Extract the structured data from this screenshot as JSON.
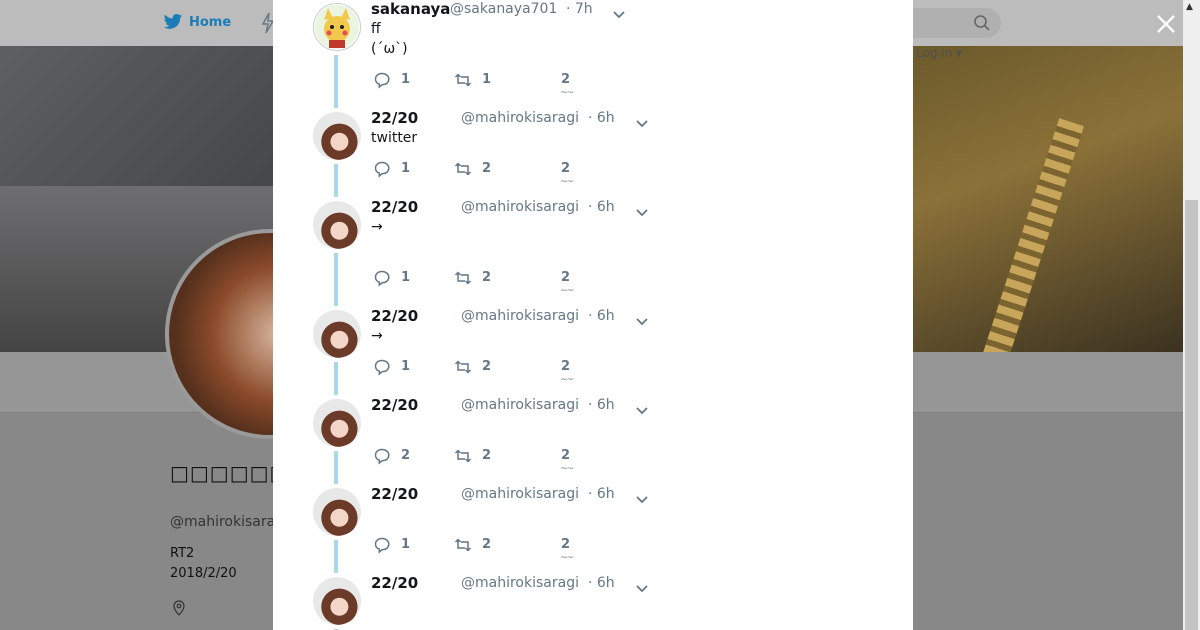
{
  "nav": {
    "home_label": "Home",
    "login_label": "Log in ▾"
  },
  "profile": {
    "name": "□□□□□□□□□□□□",
    "handle": "@mahirokisaragi",
    "bio": "RT2",
    "joined": "2018/2/20"
  },
  "tweets": [
    {
      "name": "sakanaya",
      "handle": "@sakanaya701",
      "time": "· 7h",
      "text": "ff\n(´ω`)",
      "replies": "1",
      "retweets": "1",
      "likes": "2"
    },
    {
      "name": "22/20",
      "handle": "@mahirokisaragi",
      "time": "· 6h",
      "text": "twitter",
      "replies": "1",
      "retweets": "2",
      "likes": "2"
    },
    {
      "name": "22/20",
      "handle": "@mahirokisaragi",
      "time": "· 6h",
      "text": "→",
      "replies": "1",
      "retweets": "2",
      "likes": "2"
    },
    {
      "name": "22/20",
      "handle": "@mahirokisaragi",
      "time": "· 6h",
      "text": "→",
      "replies": "1",
      "retweets": "2",
      "likes": "2"
    },
    {
      "name": "22/20",
      "handle": "@mahirokisaragi",
      "time": "· 6h",
      "text": "",
      "replies": "2",
      "retweets": "2",
      "likes": "2"
    },
    {
      "name": "22/20",
      "handle": "@mahirokisaragi",
      "time": "· 6h",
      "text": "",
      "replies": "1",
      "retweets": "2",
      "likes": "2"
    },
    {
      "name": "22/20",
      "handle": "@mahirokisaragi",
      "time": "· 6h",
      "text": "",
      "replies": "",
      "retweets": "",
      "likes": ""
    }
  ],
  "like_deco": "~~",
  "colors": {
    "twitter_blue": "#1da1f2",
    "thread_line": "#a8d8ea",
    "meta_gray": "#657786"
  }
}
